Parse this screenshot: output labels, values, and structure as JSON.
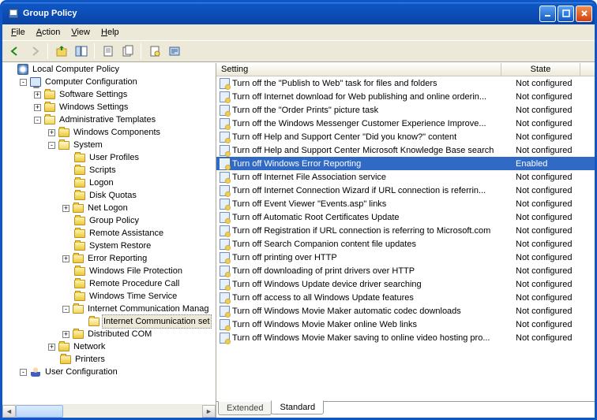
{
  "window": {
    "title": "Group Policy"
  },
  "menus": {
    "file": "File",
    "action": "Action",
    "view": "View",
    "help": "Help"
  },
  "tree": {
    "root": "Local Computer Policy",
    "computer_config": "Computer Configuration",
    "software_settings": "Software Settings",
    "windows_settings": "Windows Settings",
    "admin_templates": "Administrative Templates",
    "windows_components": "Windows Components",
    "system": "System",
    "user_profiles": "User Profiles",
    "scripts": "Scripts",
    "logon": "Logon",
    "disk_quotas": "Disk Quotas",
    "net_logon": "Net Logon",
    "group_policy": "Group Policy",
    "remote_assistance": "Remote Assistance",
    "system_restore": "System Restore",
    "error_reporting": "Error Reporting",
    "windows_file_protection": "Windows File Protection",
    "remote_procedure_call": "Remote Procedure Call",
    "windows_time_service": "Windows Time Service",
    "internet_comm_mgmt": "Internet Communication Manag",
    "internet_comm_settings": "Internet Communication set",
    "distributed_com": "Distributed COM",
    "network": "Network",
    "printers": "Printers",
    "user_config": "User Configuration"
  },
  "columns": {
    "setting": "Setting",
    "state": "State"
  },
  "list": [
    {
      "setting": "Turn off the \"Publish to Web\" task for files and folders",
      "state": "Not configured",
      "selected": false
    },
    {
      "setting": "Turn off Internet download for Web publishing and online orderin...",
      "state": "Not configured",
      "selected": false
    },
    {
      "setting": "Turn off the \"Order Prints\" picture task",
      "state": "Not configured",
      "selected": false
    },
    {
      "setting": "Turn off the Windows Messenger Customer Experience Improve...",
      "state": "Not configured",
      "selected": false
    },
    {
      "setting": "Turn off Help and Support Center \"Did you know?\" content",
      "state": "Not configured",
      "selected": false
    },
    {
      "setting": "Turn off Help and Support Center Microsoft Knowledge Base search",
      "state": "Not configured",
      "selected": false
    },
    {
      "setting": "Turn off Windows Error Reporting",
      "state": "Enabled",
      "selected": true
    },
    {
      "setting": "Turn off Internet File Association service",
      "state": "Not configured",
      "selected": false
    },
    {
      "setting": "Turn off Internet Connection Wizard if URL connection is referrin...",
      "state": "Not configured",
      "selected": false
    },
    {
      "setting": "Turn off Event Viewer \"Events.asp\" links",
      "state": "Not configured",
      "selected": false
    },
    {
      "setting": "Turn off Automatic Root Certificates Update",
      "state": "Not configured",
      "selected": false
    },
    {
      "setting": "Turn off Registration if URL connection is referring to Microsoft.com",
      "state": "Not configured",
      "selected": false
    },
    {
      "setting": "Turn off Search Companion content file updates",
      "state": "Not configured",
      "selected": false
    },
    {
      "setting": "Turn off printing over HTTP",
      "state": "Not configured",
      "selected": false
    },
    {
      "setting": "Turn off downloading of print drivers over HTTP",
      "state": "Not configured",
      "selected": false
    },
    {
      "setting": "Turn off Windows Update device driver searching",
      "state": "Not configured",
      "selected": false
    },
    {
      "setting": "Turn off access to all Windows Update features",
      "state": "Not configured",
      "selected": false
    },
    {
      "setting": "Turn off Windows Movie Maker automatic codec downloads",
      "state": "Not configured",
      "selected": false
    },
    {
      "setting": "Turn off Windows Movie Maker online Web links",
      "state": "Not configured",
      "selected": false
    },
    {
      "setting": "Turn off Windows Movie Maker saving to online video hosting pro...",
      "state": "Not configured",
      "selected": false
    }
  ],
  "tabs": {
    "extended": "Extended",
    "standard": "Standard"
  }
}
